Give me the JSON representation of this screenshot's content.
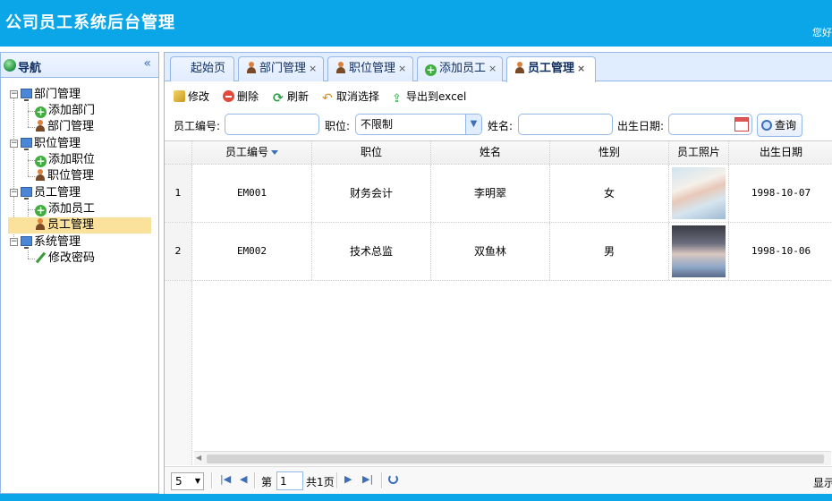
{
  "header": {
    "title": "公司员工系统后台管理",
    "welcome": "您好"
  },
  "nav": {
    "title": "导航",
    "collapse": "«",
    "groups": [
      {
        "label": "部门管理",
        "children": [
          "添加部门",
          "部门管理"
        ]
      },
      {
        "label": "职位管理",
        "children": [
          "添加职位",
          "职位管理"
        ]
      },
      {
        "label": "员工管理",
        "children": [
          "添加员工",
          "员工管理"
        ]
      },
      {
        "label": "系统管理",
        "children": [
          "修改密码"
        ]
      }
    ],
    "selected": "员工管理"
  },
  "tabs": [
    {
      "label": "起始页",
      "icon": "none",
      "closable": false
    },
    {
      "label": "部门管理",
      "icon": "user-icon",
      "closable": true
    },
    {
      "label": "职位管理",
      "icon": "user-icon",
      "closable": true
    },
    {
      "label": "添加员工",
      "icon": "add-icon",
      "closable": true
    },
    {
      "label": "员工管理",
      "icon": "user-icon",
      "closable": true,
      "active": true
    }
  ],
  "tab_close": "×",
  "toolbar": {
    "edit": "修改",
    "delete": "删除",
    "refresh": "刷新",
    "cancel_select": "取消选择",
    "export": "导出到excel"
  },
  "search": {
    "emp_no_label": "员工编号:",
    "emp_no_value": "",
    "position_label": "职位:",
    "position_value": "不限制",
    "name_label": "姓名:",
    "name_value": "",
    "birth_label": "出生日期:",
    "birth_value": "",
    "query_button": "查询"
  },
  "grid": {
    "columns": [
      "员工编号",
      "职位",
      "姓名",
      "性别",
      "员工照片",
      "出生日期"
    ],
    "rows": [
      {
        "rownum": "1",
        "emp_no": "EM001",
        "position": "财务会计",
        "name": "李明翠",
        "gender": "女",
        "birth": "1998-10-07"
      },
      {
        "rownum": "2",
        "emp_no": "EM002",
        "position": "技术总监",
        "name": "双鱼林",
        "gender": "男",
        "birth": "1998-10-06"
      }
    ]
  },
  "pager": {
    "page_size": "5",
    "page_prefix": "第",
    "page_value": "1",
    "page_total": "共1页",
    "display": "显示"
  },
  "colors": {
    "header_bg": "#0aa6e8",
    "panel_border": "#95b8e7",
    "selected_bg": "#fbe29c"
  }
}
